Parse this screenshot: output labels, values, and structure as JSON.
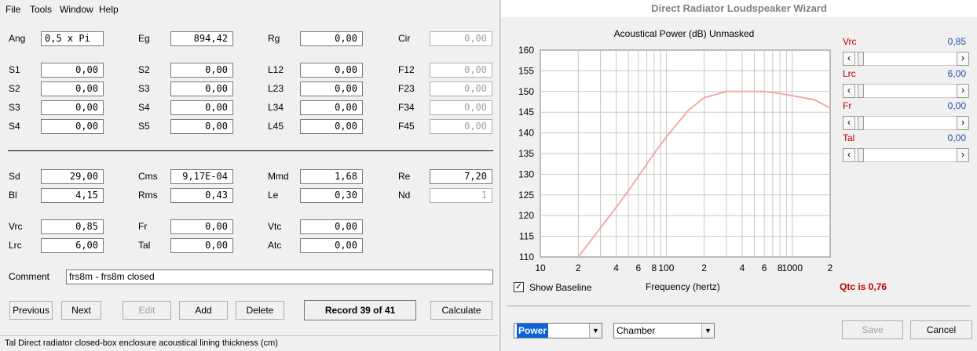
{
  "menu": [
    "File",
    "Tools",
    "Window",
    "Help"
  ],
  "rows": {
    "r0": [
      {
        "label": "Ang",
        "value": "0,5 x Pi",
        "disabled": false,
        "align": "left"
      },
      {
        "label": "Eg",
        "value": "894,42",
        "disabled": false
      },
      {
        "label": "Rg",
        "value": "0,00",
        "disabled": false
      },
      {
        "label": "Cir",
        "value": "0,00",
        "disabled": true
      }
    ],
    "r1": [
      {
        "label": "S1",
        "value": "0,00"
      },
      {
        "label": "S2",
        "value": "0,00"
      },
      {
        "label": "L12",
        "value": "0,00"
      },
      {
        "label": "F12",
        "value": "0,00",
        "disabled": true
      }
    ],
    "r2": [
      {
        "label": "S2",
        "value": "0,00"
      },
      {
        "label": "S3",
        "value": "0,00"
      },
      {
        "label": "L23",
        "value": "0,00"
      },
      {
        "label": "F23",
        "value": "0,00",
        "disabled": true
      }
    ],
    "r3": [
      {
        "label": "S3",
        "value": "0,00"
      },
      {
        "label": "S4",
        "value": "0,00"
      },
      {
        "label": "L34",
        "value": "0,00"
      },
      {
        "label": "F34",
        "value": "0,00",
        "disabled": true
      }
    ],
    "r4": [
      {
        "label": "S4",
        "value": "0,00"
      },
      {
        "label": "S5",
        "value": "0,00"
      },
      {
        "label": "L45",
        "value": "0,00"
      },
      {
        "label": "F45",
        "value": "0,00",
        "disabled": true
      }
    ],
    "r5": [
      {
        "label": "Sd",
        "value": "29,00"
      },
      {
        "label": "Cms",
        "value": "9,17E-04"
      },
      {
        "label": "Mmd",
        "value": "1,68"
      },
      {
        "label": "Re",
        "value": "7,20"
      }
    ],
    "r6": [
      {
        "label": "Bl",
        "value": "4,15"
      },
      {
        "label": "Rms",
        "value": "0,43"
      },
      {
        "label": "Le",
        "value": "0,30"
      },
      {
        "label": "Nd",
        "value": "1",
        "disabled": true
      }
    ],
    "r7": [
      {
        "label": "Vrc",
        "value": "0,85"
      },
      {
        "label": "Fr",
        "value": "0,00"
      },
      {
        "label": "Vtc",
        "value": "0,00"
      }
    ],
    "r8": [
      {
        "label": "Lrc",
        "value": "6,00"
      },
      {
        "label": "Tal",
        "value": "0,00"
      },
      {
        "label": "Atc",
        "value": "0,00"
      }
    ]
  },
  "comment": {
    "label": "Comment",
    "value": "frs8m - frs8m closed"
  },
  "buttons": {
    "previous": "Previous",
    "next": "Next",
    "edit": "Edit",
    "add": "Add",
    "delete": "Delete",
    "calculate": "Calculate"
  },
  "record": "Record 39 of 41",
  "status": "Tal   Direct radiator closed-box enclosure acoustical lining thickness  (cm)",
  "wizard": {
    "title": "Direct Radiator Loudspeaker Wizard",
    "sliders": [
      {
        "label": "Vrc",
        "value": "0,85",
        "pos": 0.02
      },
      {
        "label": "Lrc",
        "value": "6,00",
        "pos": 0.02
      },
      {
        "label": "Fr",
        "value": "0,00",
        "pos": 0.02
      },
      {
        "label": "Tal",
        "value": "0,00",
        "pos": 0.02
      }
    ],
    "show_baseline": "Show Baseline",
    "qtc": "Qtc is 0,76",
    "mode_select": "Power",
    "env_select": "Chamber",
    "save": "Save",
    "cancel": "Cancel"
  },
  "chart_data": {
    "type": "line",
    "title": "Acoustical Power (dB)   Unmasked",
    "xlabel": "Frequency (hertz)",
    "ylabel": "",
    "xscale": "log",
    "xlim": [
      10,
      2000
    ],
    "ylim": [
      110,
      160
    ],
    "yticks": [
      110,
      115,
      120,
      125,
      130,
      135,
      140,
      145,
      150,
      155,
      160
    ],
    "xtick_labels": [
      {
        "v": 10,
        "t": "10"
      },
      {
        "v": 20,
        "t": "2"
      },
      {
        "v": 40,
        "t": "4"
      },
      {
        "v": 60,
        "t": "6"
      },
      {
        "v": 80,
        "t": "8"
      },
      {
        "v": 100,
        "t": "100"
      },
      {
        "v": 200,
        "t": "2"
      },
      {
        "v": 400,
        "t": "4"
      },
      {
        "v": 600,
        "t": "6"
      },
      {
        "v": 800,
        "t": "8"
      },
      {
        "v": 1000,
        "t": "1000"
      },
      {
        "v": 2000,
        "t": "2"
      }
    ],
    "grid": true,
    "series": [
      {
        "color": "#f4a9a9",
        "x": [
          20,
          30,
          40,
          50,
          60,
          80,
          100,
          150,
          200,
          300,
          400,
          500,
          600,
          800,
          1000,
          1500,
          2000
        ],
        "y": [
          110,
          117,
          122,
          126,
          129.5,
          135,
          139,
          145.5,
          148.5,
          150,
          150,
          150,
          150,
          149.5,
          149,
          148,
          146
        ]
      }
    ]
  }
}
